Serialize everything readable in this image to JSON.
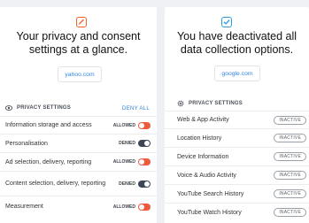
{
  "left": {
    "icon": "edit-check-icon",
    "headline_line1": "Your privacy and consent",
    "headline_line2": "settings at a glance.",
    "domain": "yahoo.com",
    "section_title": "PRIVACY SETTINGS",
    "section_icon": "eye-icon",
    "deny_all_label": "DENY ALL",
    "accent": "#f25f2c",
    "items": [
      {
        "label": "Information storage and access",
        "state": "ALLOWED",
        "enabled": true
      },
      {
        "label": "Personalisation",
        "state": "DENIED",
        "enabled": false
      },
      {
        "label": "Ad selection, delivery, reporting",
        "state": "ALLOWED",
        "enabled": true
      },
      {
        "label": "Content selection, delivery, reporting",
        "state": "DENIED",
        "enabled": false
      },
      {
        "label": "Measurement",
        "state": "ALLOWED",
        "enabled": true
      }
    ]
  },
  "right": {
    "icon": "check-square-icon",
    "headline_line1": "You have deactivated all",
    "headline_line2": "data collection options.",
    "domain": "google.com",
    "section_title": "PRIVACY SETTINGS",
    "section_icon": "gear-icon",
    "accent": "#2f9be6",
    "items": [
      {
        "label": "Web & App Activity",
        "status": "INACTIVE"
      },
      {
        "label": "Location History",
        "status": "INACTIVE"
      },
      {
        "label": "Device Information",
        "status": "INACTIVE"
      },
      {
        "label": "Voice & Audio Activity",
        "status": "INACTIVE"
      },
      {
        "label": "YouTube Search History",
        "status": "INACTIVE"
      },
      {
        "label": "YouTube Watch History",
        "status": "INACTIVE"
      }
    ]
  }
}
